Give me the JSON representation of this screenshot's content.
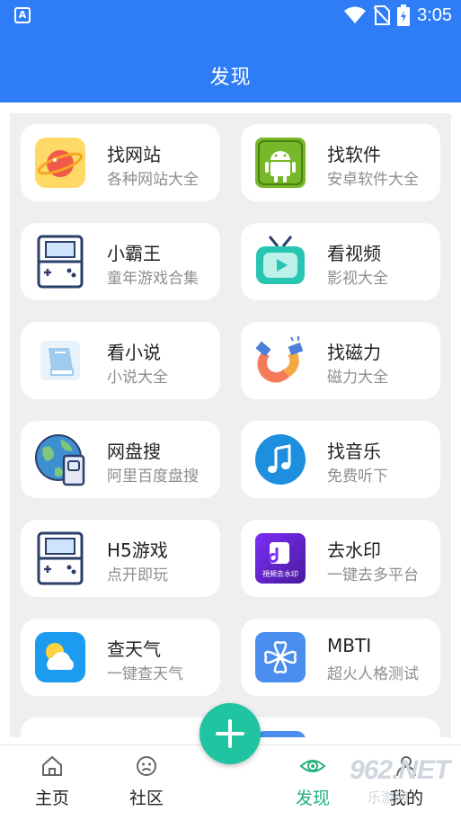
{
  "status_bar": {
    "time": "3:05",
    "app_glyph": "A"
  },
  "header": {
    "title": "发现"
  },
  "cards": [
    {
      "name": "找网站",
      "desc": "各种网站大全",
      "icon": "planet-icon"
    },
    {
      "name": "找软件",
      "desc": "安卓软件大全",
      "icon": "android-icon"
    },
    {
      "name": "小霸王",
      "desc": "童年游戏合集",
      "icon": "game-console-icon"
    },
    {
      "name": "看视频",
      "desc": "影视大全",
      "icon": "tv-icon"
    },
    {
      "name": "看小说",
      "desc": "小说大全",
      "icon": "book-icon"
    },
    {
      "name": "找磁力",
      "desc": "磁力大全",
      "icon": "magnet-icon"
    },
    {
      "name": "网盘搜",
      "desc": "阿里百度盘搜",
      "icon": "globe-disk-icon"
    },
    {
      "name": "找音乐",
      "desc": "免费听下",
      "icon": "music-icon"
    },
    {
      "name": "H5游戏",
      "desc": "点开即玩",
      "icon": "game-console-icon"
    },
    {
      "name": "去水印",
      "desc": "一键去多平台",
      "icon": "watermark-icon",
      "icon_text": "視频去水印"
    },
    {
      "name": "查天气",
      "desc": "一键查天气",
      "icon": "weather-icon"
    },
    {
      "name": "MBTI",
      "desc": "超火人格测试",
      "icon": "clover-icon"
    }
  ],
  "tabs": [
    {
      "label": "主页",
      "icon": "home-icon"
    },
    {
      "label": "社区",
      "icon": "smiley-icon"
    },
    {
      "label": "发现",
      "icon": "eye-icon",
      "active": true
    },
    {
      "label": "我的",
      "icon": "user-icon"
    }
  ],
  "watermark": {
    "number": "962.NET",
    "site": "乐游网"
  },
  "colors": {
    "primary": "#2f7df6",
    "fab": "#20c4a0",
    "active_tab": "#22b07a"
  }
}
